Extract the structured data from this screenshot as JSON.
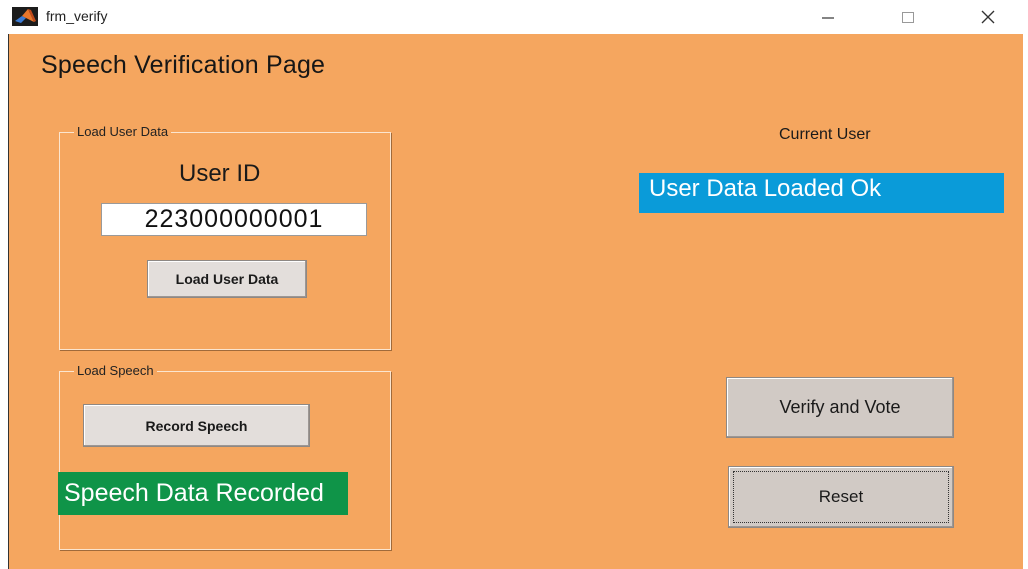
{
  "window": {
    "title": "frm_verify",
    "controls": [
      "minimize-icon",
      "maximize-icon",
      "close-icon"
    ]
  },
  "page": {
    "heading": "Speech Verification Page"
  },
  "load_user_panel": {
    "title": "Load User Data",
    "user_id_label": "User ID",
    "user_id_value": "223000000001",
    "load_button": "Load User Data"
  },
  "load_speech_panel": {
    "title": "Load Speech",
    "record_button": "Record Speech",
    "status": "Speech Data Recorded"
  },
  "current_user": {
    "label": "Current User",
    "status": "User Data Loaded Ok"
  },
  "actions": {
    "verify_button": "Verify and Vote",
    "reset_button": "Reset"
  },
  "colors": {
    "background": "#f5a65f",
    "green_status": "#0f9448",
    "blue_status": "#0a9bd9",
    "button": "#e3dedb"
  }
}
